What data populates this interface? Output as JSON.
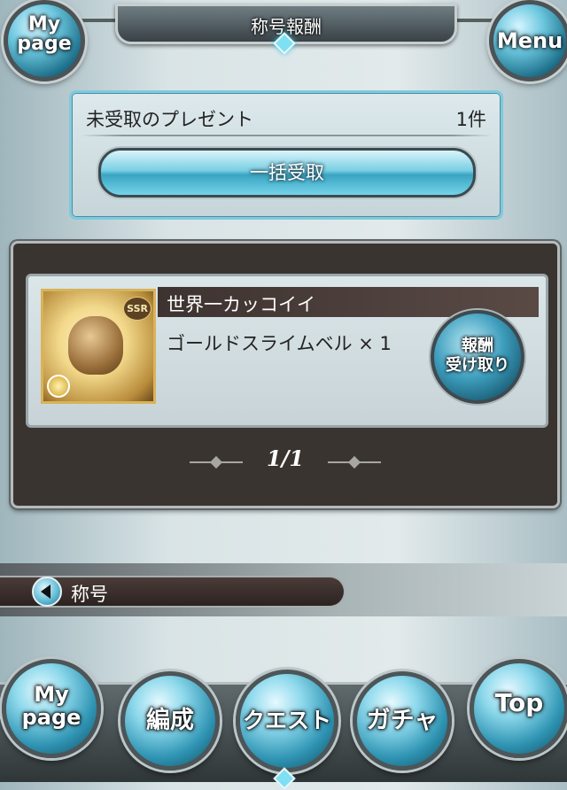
{
  "header": {
    "title": "称号報酬",
    "mypage_label": "My page",
    "menu_label": "Menu"
  },
  "present": {
    "label": "未受取のプレゼント",
    "count": "1件",
    "bulk_button": "一括受取"
  },
  "reward": {
    "badge": "SSR",
    "title": "世界一カッコイイ",
    "item": "ゴールドスライムベル × 1",
    "claim_line1": "報酬",
    "claim_line2": "受け取り"
  },
  "pagination": {
    "indicator": "1/1"
  },
  "back": {
    "label": "称号"
  },
  "footer_nav": {
    "mypage": "My page",
    "party": "編成",
    "quest": "クエスト",
    "gacha": "ガチャ",
    "top": "Top"
  },
  "colors": {
    "accent": "#5bc6df",
    "frame_dark": "#3a3430",
    "title_bar": "#4a3d39"
  }
}
